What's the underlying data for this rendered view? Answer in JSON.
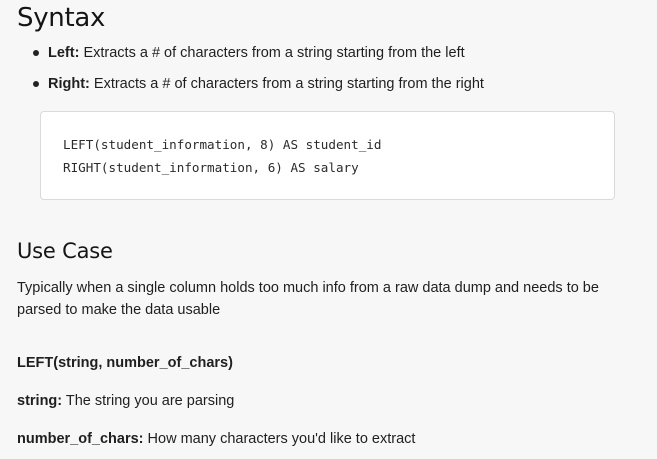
{
  "syntax": {
    "heading": "Syntax",
    "bullets": [
      {
        "term": "Left:",
        "text": " Extracts a # of characters from a string starting from the left"
      },
      {
        "term": "Right:",
        "text": " Extracts a # of characters from a string starting from the right"
      }
    ],
    "code_lines": [
      "LEFT(student_information, 8) AS student_id",
      "RIGHT(student_information, 6) AS salary"
    ]
  },
  "use_case": {
    "heading": "Use Case",
    "paragraph": "Typically when a single column holds too much info from a raw data dump and needs to be parsed to make the data usable",
    "signature": "LEFT(string, number_of_chars)",
    "definitions": [
      {
        "term": "string:",
        "text": " The string you are parsing"
      },
      {
        "term": "number_of_chars:",
        "text": " How many characters you'd like to extract"
      }
    ]
  }
}
